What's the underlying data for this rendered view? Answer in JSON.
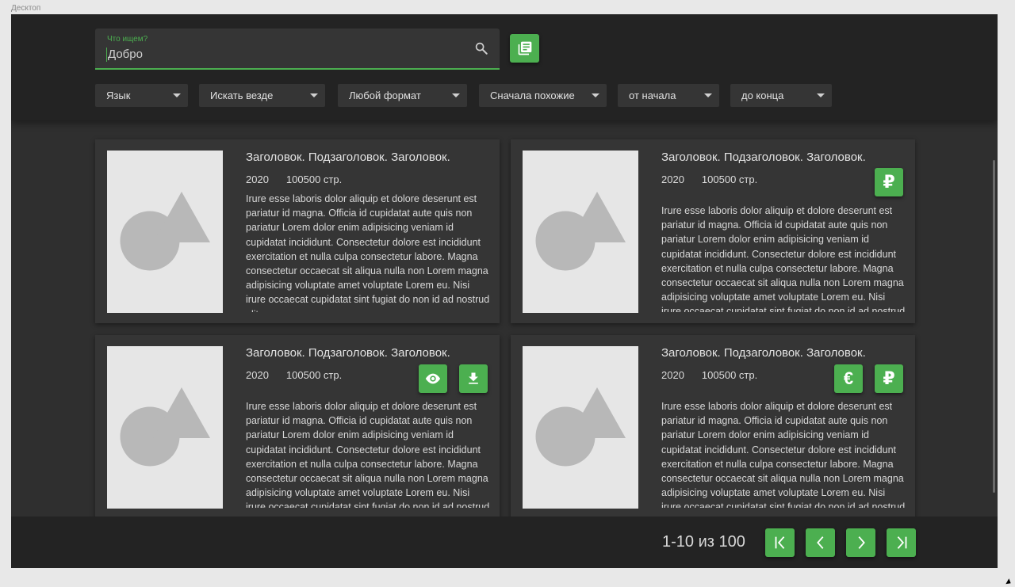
{
  "frame_label": "Десктоп",
  "search": {
    "label": "Что ищем?",
    "value": "Добро",
    "icon": "search-icon"
  },
  "catalog_button_icon": "library-books-icon",
  "filters": [
    {
      "label": "Язык"
    },
    {
      "label": "Искать везде"
    },
    {
      "label": "Любой формат"
    },
    {
      "label": "Сначала похожие"
    },
    {
      "label": "от начала"
    },
    {
      "label": "до конца"
    }
  ],
  "cards": [
    {
      "title": "Заголовок. Подзаголовок. Заголовок.",
      "year": "2020",
      "pages": "100500 стр.",
      "description": "Irure esse laboris dolor aliquip et dolore deserunt est pariatur id magna. Officia id cupidatat aute quis non pariatur Lorem dolor enim adipisicing veniam id cupidatat incididunt. Consectetur dolore est incididunt exercitation et nulla culpa consectetur labore. Magna consectetur occaecat sit aliqua nulla non Lorem magna adipisicing voluptate amet voluptate Lorem eu. Nisi irure occaecat cupidatat sint fugiat do non id ad nostrud elit.",
      "actions": []
    },
    {
      "title": "Заголовок. Подзаголовок. Заголовок.",
      "year": "2020",
      "pages": "100500 стр.",
      "description": "Irure esse laboris dolor aliquip et dolore deserunt est pariatur id magna. Officia id cupidatat aute quis non pariatur Lorem dolor enim adipisicing veniam id cupidatat incididunt. Consectetur dolore est incididunt exercitation et nulla culpa consectetur labore. Magna consectetur occaecat sit aliqua nulla non Lorem magna adipisicing voluptate amet voluptate Lorem eu. Nisi irure occaecat cupidatat sint fugiat do non id ad nostrud elit.",
      "actions": [
        {
          "icon": "ruble-icon",
          "glyph": "₽"
        }
      ]
    },
    {
      "title": "Заголовок. Подзаголовок. Заголовок.",
      "year": "2020",
      "pages": "100500 стр.",
      "description": "Irure esse laboris dolor aliquip et dolore deserunt est pariatur id magna. Officia id cupidatat aute quis non pariatur Lorem dolor enim adipisicing veniam id cupidatat incididunt. Consectetur dolore est incididunt exercitation et nulla culpa consectetur labore. Magna consectetur occaecat sit aliqua nulla non Lorem magna adipisicing voluptate amet voluptate Lorem eu. Nisi irure occaecat cupidatat sint fugiat do non id ad nostrud elit.",
      "actions": [
        {
          "icon": "eye-icon"
        },
        {
          "icon": "download-icon"
        }
      ]
    },
    {
      "title": "Заголовок. Подзаголовок. Заголовок.",
      "year": "2020",
      "pages": "100500 стр.",
      "description": "Irure esse laboris dolor aliquip et dolore deserunt est pariatur id magna. Officia id cupidatat aute quis non pariatur Lorem dolor enim adipisicing veniam id cupidatat incididunt. Consectetur dolore est incididunt exercitation et nulla culpa consectetur labore. Magna consectetur occaecat sit aliqua nulla non Lorem magna adipisicing voluptate amet voluptate Lorem eu. Nisi irure occaecat cupidatat sint fugiat do non id ad nostrud elit.",
      "actions": [
        {
          "icon": "euro-icon",
          "glyph": "€"
        },
        {
          "icon": "ruble-icon",
          "glyph": "₽"
        }
      ]
    }
  ],
  "pagination": {
    "info": "1-10 из 100",
    "buttons": [
      "first-page-icon",
      "prev-page-icon",
      "next-page-icon",
      "last-page-icon"
    ]
  },
  "colors": {
    "accent": "#4caf50",
    "background": "#2f2f2f",
    "bar": "#232323",
    "card": "#353535"
  }
}
